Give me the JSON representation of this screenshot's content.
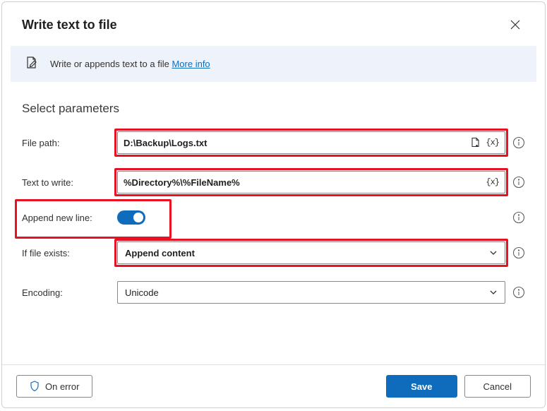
{
  "dialog": {
    "title": "Write text to file"
  },
  "banner": {
    "text": "Write or appends text to a file ",
    "link": "More info"
  },
  "section": {
    "title": "Select parameters"
  },
  "params": {
    "filePath": {
      "label": "File path:",
      "value": "D:\\Backup\\Logs.txt"
    },
    "textToWrite": {
      "label": "Text to write:",
      "value": "%Directory%\\%FileName%"
    },
    "appendNewLine": {
      "label": "Append new line:",
      "value": true
    },
    "ifFileExists": {
      "label": "If file exists:",
      "value": "Append content"
    },
    "encoding": {
      "label": "Encoding:",
      "value": "Unicode"
    }
  },
  "footer": {
    "onError": "On error",
    "save": "Save",
    "cancel": "Cancel"
  },
  "glyphs": {
    "variable": "{x}"
  }
}
